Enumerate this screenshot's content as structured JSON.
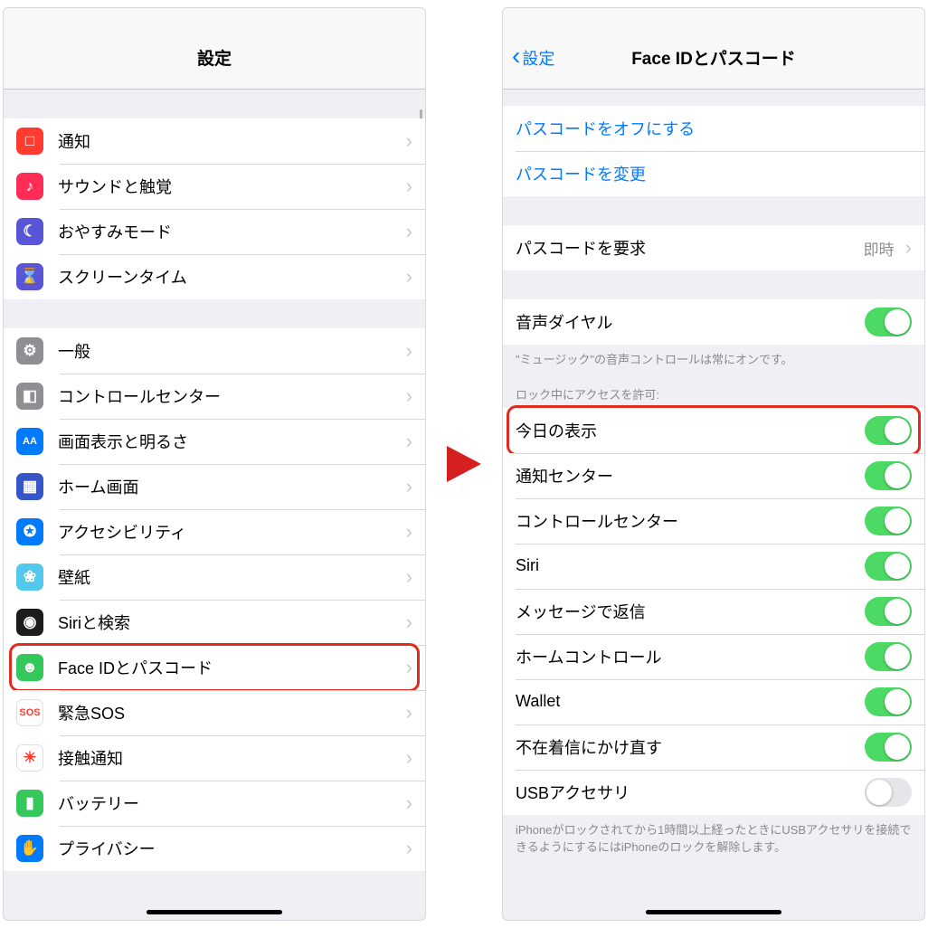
{
  "left": {
    "title": "設定",
    "groups": [
      [
        {
          "key": "notifications",
          "label": "通知",
          "color": "#ff3b30",
          "glyph": "□"
        },
        {
          "key": "sounds",
          "label": "サウンドと触覚",
          "color": "#ff2d55",
          "glyph": "♪"
        },
        {
          "key": "dnd",
          "label": "おやすみモード",
          "color": "#5856d6",
          "glyph": "☾"
        },
        {
          "key": "screentime",
          "label": "スクリーンタイム",
          "color": "#5856d6",
          "glyph": "⌛"
        }
      ],
      [
        {
          "key": "general",
          "label": "一般",
          "color": "#8e8e93",
          "glyph": "⚙"
        },
        {
          "key": "controlcenter",
          "label": "コントロールセンター",
          "color": "#8e8e93",
          "glyph": "◧"
        },
        {
          "key": "display",
          "label": "画面表示と明るさ",
          "color": "#007aff",
          "glyph": "AA"
        },
        {
          "key": "home",
          "label": "ホーム画面",
          "color": "#3555c9",
          "glyph": "▦"
        },
        {
          "key": "accessibility",
          "label": "アクセシビリティ",
          "color": "#007aff",
          "glyph": "✪"
        },
        {
          "key": "wallpaper",
          "label": "壁紙",
          "color": "#54c7ec",
          "glyph": "❀"
        },
        {
          "key": "siri",
          "label": "Siriと検索",
          "color": "#1c1c1e",
          "glyph": "◉"
        },
        {
          "key": "faceid",
          "label": "Face IDとパスコード",
          "color": "#34c759",
          "glyph": "☻",
          "highlight": true
        },
        {
          "key": "sos",
          "label": "緊急SOS",
          "color": "#ffffff",
          "glyph": "SOS",
          "textcolor": "#ff3b30"
        },
        {
          "key": "exposure",
          "label": "接触通知",
          "color": "#ffffff",
          "glyph": "☀",
          "textcolor": "#ff3b30"
        },
        {
          "key": "battery",
          "label": "バッテリー",
          "color": "#34c759",
          "glyph": "▮"
        },
        {
          "key": "privacy",
          "label": "プライバシー",
          "color": "#007aff",
          "glyph": "✋"
        }
      ]
    ]
  },
  "right": {
    "back": "設定",
    "title": "Face IDとパスコード",
    "links": [
      {
        "key": "turnoff",
        "label": "パスコードをオフにする"
      },
      {
        "key": "change",
        "label": "パスコードを変更"
      }
    ],
    "require": {
      "label": "パスコードを要求",
      "value": "即時"
    },
    "voice": {
      "label": "音声ダイヤル",
      "on": true,
      "note": "\"ミュージック\"の音声コントロールは常にオンです。"
    },
    "lockSectionTitle": "ロック中にアクセスを許可:",
    "lockAccess": [
      {
        "key": "today",
        "label": "今日の表示",
        "on": true,
        "highlight": true
      },
      {
        "key": "notifcenter",
        "label": "通知センター",
        "on": true
      },
      {
        "key": "controlcenter",
        "label": "コントロールセンター",
        "on": true
      },
      {
        "key": "siri",
        "label": "Siri",
        "on": true
      },
      {
        "key": "reply",
        "label": "メッセージで返信",
        "on": true
      },
      {
        "key": "homecontrol",
        "label": "ホームコントロール",
        "on": true
      },
      {
        "key": "wallet",
        "label": "Wallet",
        "on": true
      },
      {
        "key": "callback",
        "label": "不在着信にかけ直す",
        "on": true
      },
      {
        "key": "usb",
        "label": "USBアクセサリ",
        "on": false
      }
    ],
    "usbNote": "iPhoneがロックされてから1時間以上経ったときにUSBアクセサリを接続できるようにするにはiPhoneのロックを解除します。"
  }
}
